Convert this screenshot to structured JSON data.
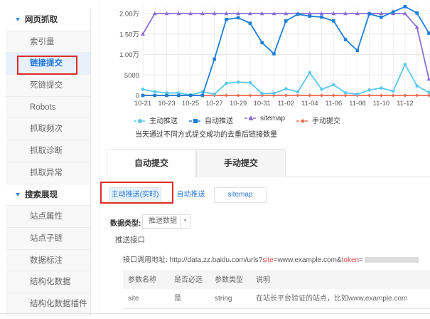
{
  "sidebar": {
    "items": [
      {
        "label": "网页抓取",
        "type": "section"
      },
      {
        "label": "索引量"
      },
      {
        "label": "链接提交",
        "active": true
      },
      {
        "label": "死链提交"
      },
      {
        "label": "Robots"
      },
      {
        "label": "抓取频次"
      },
      {
        "label": "抓取诊断"
      },
      {
        "label": "抓取异常"
      },
      {
        "label": "搜索展现",
        "type": "section"
      },
      {
        "label": "站点属性"
      },
      {
        "label": "站点子链"
      },
      {
        "label": "数据标注"
      },
      {
        "label": "结构化数据"
      },
      {
        "label": "结构化数据插件"
      }
    ]
  },
  "chart_data": {
    "type": "line",
    "x": [
      "10-21",
      "10-22",
      "10-23",
      "10-24",
      "10-25",
      "10-26",
      "10-27",
      "10-28",
      "10-29",
      "10-30",
      "10-31",
      "11-01",
      "11-02",
      "11-03",
      "11-04",
      "11-05",
      "11-06",
      "11-07",
      "11-08",
      "11-09",
      "11-10",
      "11-11",
      "11-12",
      "11-13",
      "11-14"
    ],
    "xticks": [
      "10-21",
      "10-23",
      "10-25",
      "10-27",
      "10-29",
      "10-31",
      "11-02",
      "11-04",
      "11-06",
      "11-08",
      "11-10",
      "11-12"
    ],
    "yticks": [
      {
        "v": 0,
        "label": "0"
      },
      {
        "v": 5000,
        "label": "5000"
      },
      {
        "v": 10000,
        "label": "1.00万"
      },
      {
        "v": 15000,
        "label": "1.50万"
      },
      {
        "v": 20000,
        "label": "2.00万"
      }
    ],
    "ylim": [
      0,
      20000
    ],
    "series": [
      {
        "name": "主动推送",
        "color": "#5bc8ea",
        "marker": "circle",
        "values": [
          1500,
          900,
          600,
          600,
          100,
          900,
          300,
          2950,
          3240,
          3120,
          460,
          520,
          1620,
          870,
          5550,
          1500,
          2600,
          640,
          290,
          1330,
          1790,
          1040,
          7570,
          2310,
          750
        ]
      },
      {
        "name": "自动推送",
        "color": "#1f7fd8",
        "marker": "square",
        "values": [
          0,
          0,
          0,
          0,
          0,
          0,
          8850,
          18550,
          18960,
          17630,
          12890,
          10170,
          18200,
          19830,
          19360,
          19130,
          18200,
          13640,
          10980,
          19940,
          19080,
          20400,
          21680,
          20120,
          15200
        ]
      },
      {
        "name": "sitemap",
        "color": "#8b6fd6",
        "marker": "triangle",
        "values": [
          15000,
          20000,
          20000,
          20000,
          20000,
          20000,
          20000,
          20000,
          20000,
          20000,
          20000,
          20000,
          20000,
          20000,
          20000,
          20000,
          20000,
          20000,
          20000,
          20000,
          20000,
          20000,
          20000,
          16650,
          4000
        ]
      },
      {
        "name": "手动提交",
        "color": "#f06a4f",
        "marker": "diamond",
        "values": [
          0,
          0,
          0,
          0,
          0,
          0,
          0,
          0,
          0,
          0,
          0,
          0,
          0,
          0,
          0,
          0,
          0,
          0,
          0,
          0,
          0,
          0,
          0,
          0,
          0
        ]
      }
    ],
    "note": "当天通过不同方式提交成功的去重后链接数量"
  },
  "tabs": [
    "自动提交",
    "手动提交"
  ],
  "subtabs": [
    "主动推送(实时)",
    "自动推送",
    "sitemap"
  ],
  "data_type": {
    "label": "数据类型:",
    "value": "推送数据"
  },
  "section_title": "推送接口",
  "url": {
    "label": "接口调用地址:",
    "pre": "http://data.zz.baidu.com/urls?",
    "k1": "site",
    "mid": "=www.example.com&",
    "k2": "token",
    "post": "="
  },
  "table": {
    "headers": [
      "参数名称",
      "是否必选",
      "参数类型",
      "说明"
    ],
    "rows": [
      [
        "site",
        "是",
        "string",
        "在站长平台验证的站点，比如www.example.com"
      ]
    ]
  }
}
